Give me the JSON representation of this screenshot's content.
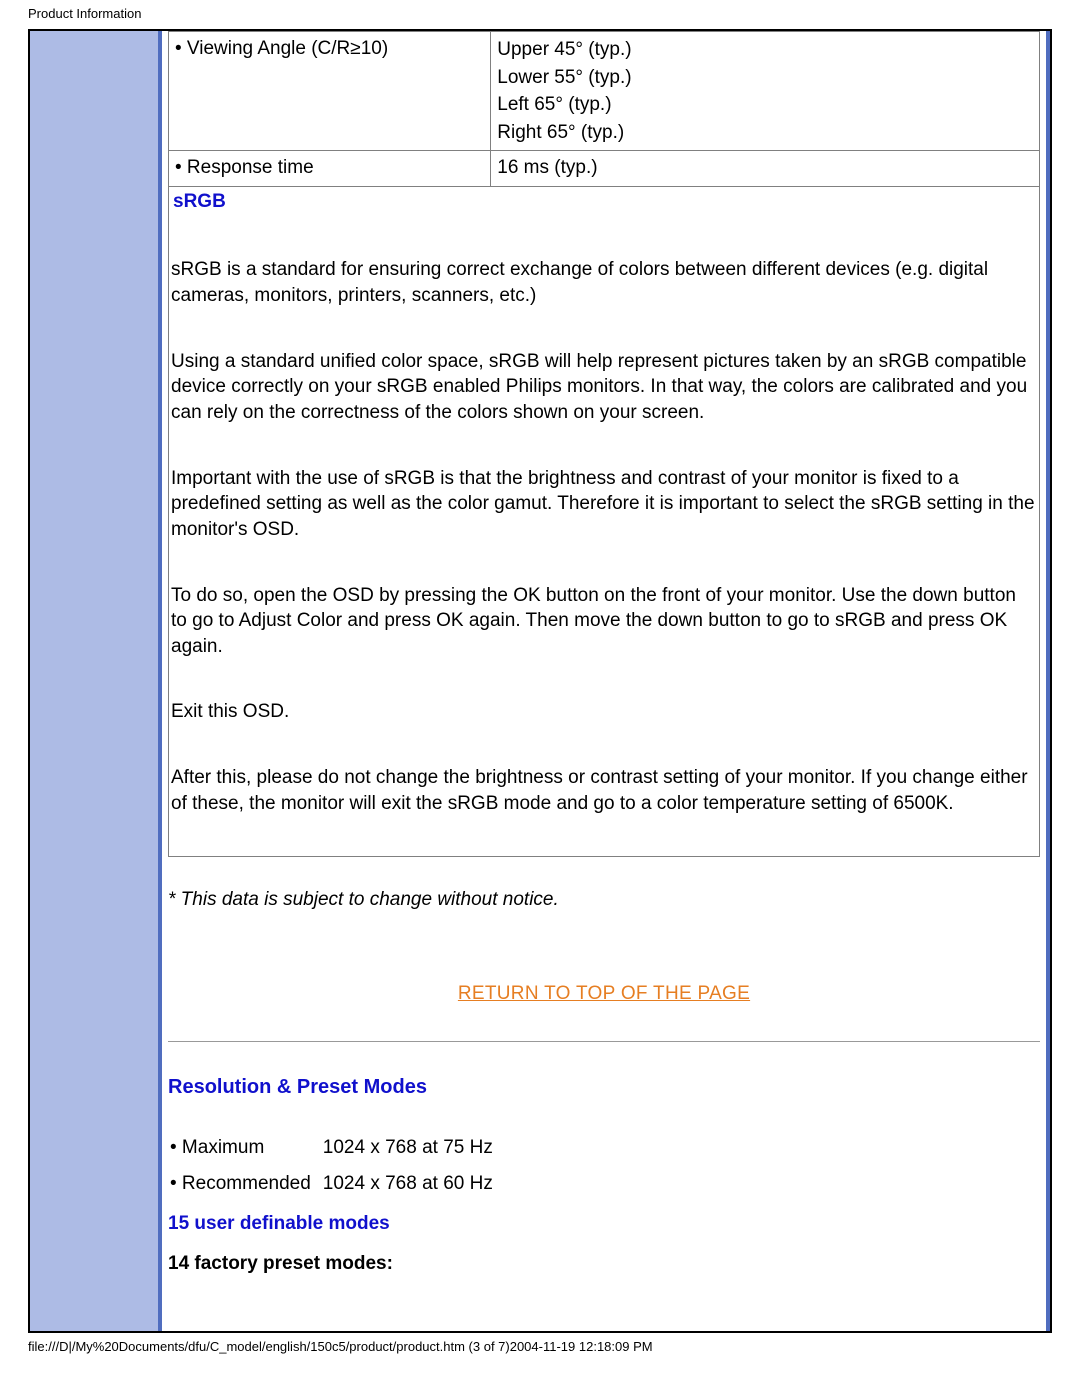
{
  "header": "Product Information",
  "spec_rows": [
    {
      "label": "• Viewing Angle (C/R≥10)",
      "value": "Upper 45° (typ.)\nLower 55° (typ.)\nLeft 65° (typ.)\nRight 65° (typ.)"
    },
    {
      "label": "• Response time",
      "value": "16 ms (typ.)"
    }
  ],
  "srgb": {
    "title": "sRGB",
    "paragraphs": [
      "sRGB is a standard for ensuring correct exchange of colors between different devices (e.g. digital cameras, monitors, printers, scanners, etc.)",
      "Using a standard unified color space, sRGB will help represent pictures taken by an sRGB compatible device correctly on your sRGB enabled Philips monitors. In that way, the colors are calibrated and you can rely on the correctness of the colors shown on your screen.",
      "Important with the use of sRGB is that the brightness and contrast of your monitor is fixed to a predefined setting as well as the color gamut. Therefore it is important to select the sRGB setting in the monitor's OSD.",
      "To do so, open the OSD by pressing the OK button on the front of your monitor. Use the down button to go to Adjust Color and press OK again. Then move the down button to go to sRGB and press OK again.",
      "Exit this OSD.",
      "After this, please do not change the brightness or contrast setting of your monitor. If you change either of these, the monitor will exit the sRGB mode and go to a color temperature setting of 6500K."
    ]
  },
  "footnote": "* This data is subject to change without notice.",
  "toplink": "RETURN TO TOP OF THE PAGE",
  "resolution": {
    "heading": "Resolution & Preset Modes",
    "rows": [
      {
        "label": "• Maximum",
        "value": "1024 x 768 at 75 Hz"
      },
      {
        "label": "• Recommended",
        "value": "1024 x 768 at 60 Hz"
      }
    ],
    "user_modes": "15 user definable modes",
    "factory_modes": "14 factory preset modes:"
  },
  "footer": "file:///D|/My%20Documents/dfu/C_model/english/150c5/product/product.htm (3 of 7)2004-11-19 12:18:09 PM"
}
